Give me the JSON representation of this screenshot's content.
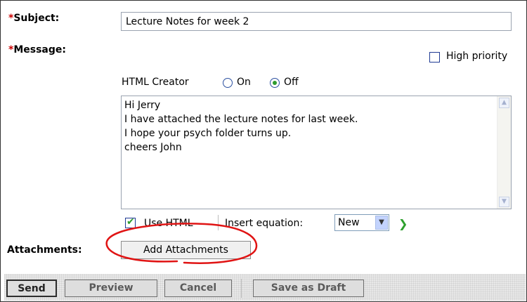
{
  "form": {
    "subject": {
      "required_marker": "*",
      "label": "Subject:",
      "value": "Lecture Notes for week 2"
    },
    "message": {
      "required_marker": "*",
      "label": "Message:",
      "body": "Hi Jerry\nI have attached the lecture notes for last week.\nI hope your psych folder turns up.\ncheers John"
    },
    "high_priority": {
      "label": "High priority",
      "checked": false
    },
    "html_creator": {
      "label": "HTML Creator",
      "options": [
        {
          "label": "On",
          "selected": false
        },
        {
          "label": "Off",
          "selected": true
        }
      ]
    },
    "use_html": {
      "label": "Use HTML",
      "checked": true
    },
    "insert_equation": {
      "label": "Insert equation:",
      "selected": "New"
    },
    "attachments": {
      "label": "Attachments:",
      "button_label": "Add Attachments"
    }
  },
  "toolbar": {
    "send": "Send",
    "preview": "Preview",
    "cancel": "Cancel",
    "save_draft": "Save as Draft"
  },
  "colors": {
    "required": "#cc0000",
    "annotation": "#e01414",
    "checkmark": "#2e9c2e"
  }
}
